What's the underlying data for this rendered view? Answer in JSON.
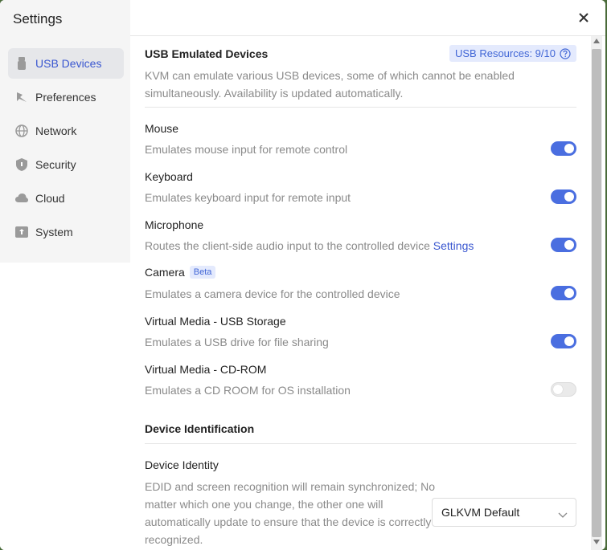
{
  "sidebar": {
    "title": "Settings",
    "items": [
      {
        "label": "USB Devices",
        "icon": "usb-icon",
        "active": true
      },
      {
        "label": "Preferences",
        "icon": "preferences-icon",
        "active": false
      },
      {
        "label": "Network",
        "icon": "globe-icon",
        "active": false
      },
      {
        "label": "Security",
        "icon": "shield-icon",
        "active": false
      },
      {
        "label": "Cloud",
        "icon": "cloud-icon",
        "active": false
      },
      {
        "label": "System",
        "icon": "system-icon",
        "active": false
      }
    ]
  },
  "usb": {
    "title": "USB Emulated Devices",
    "resources_badge": "USB Resources: 9/10",
    "description": "KVM can emulate various USB devices, some of which cannot be enabled simultaneously. Availability is updated automatically.",
    "devices": [
      {
        "name": "Mouse",
        "desc": "Emulates mouse input for remote control",
        "enabled": true
      },
      {
        "name": "Keyboard",
        "desc": "Emulates keyboard input for remote input",
        "enabled": true
      },
      {
        "name": "Microphone",
        "desc": "Routes the client-side audio input to the controlled device",
        "link": "Settings",
        "enabled": true
      },
      {
        "name": "Camera",
        "badge": "Beta",
        "desc": "Emulates a camera device for the controlled device",
        "enabled": true
      },
      {
        "name": "Virtual Media - USB Storage",
        "desc": "Emulates a USB drive for file sharing",
        "enabled": true
      },
      {
        "name": "Virtual Media - CD-ROM",
        "desc": "Emulates a CD ROOM for OS installation",
        "enabled": false
      }
    ]
  },
  "identification": {
    "title": "Device Identification",
    "identity_label": "Device Identity",
    "identity_desc": "EDID and screen recognition will remain synchronized; No matter which one you change, the other one will automatically update to ensure that the device is correctly recognized.",
    "identity_value": "GLKVM Default"
  },
  "colors": {
    "accent": "#4a6ee0",
    "active_nav_text": "#3a57d0",
    "badge_bg": "#e4eafd"
  }
}
